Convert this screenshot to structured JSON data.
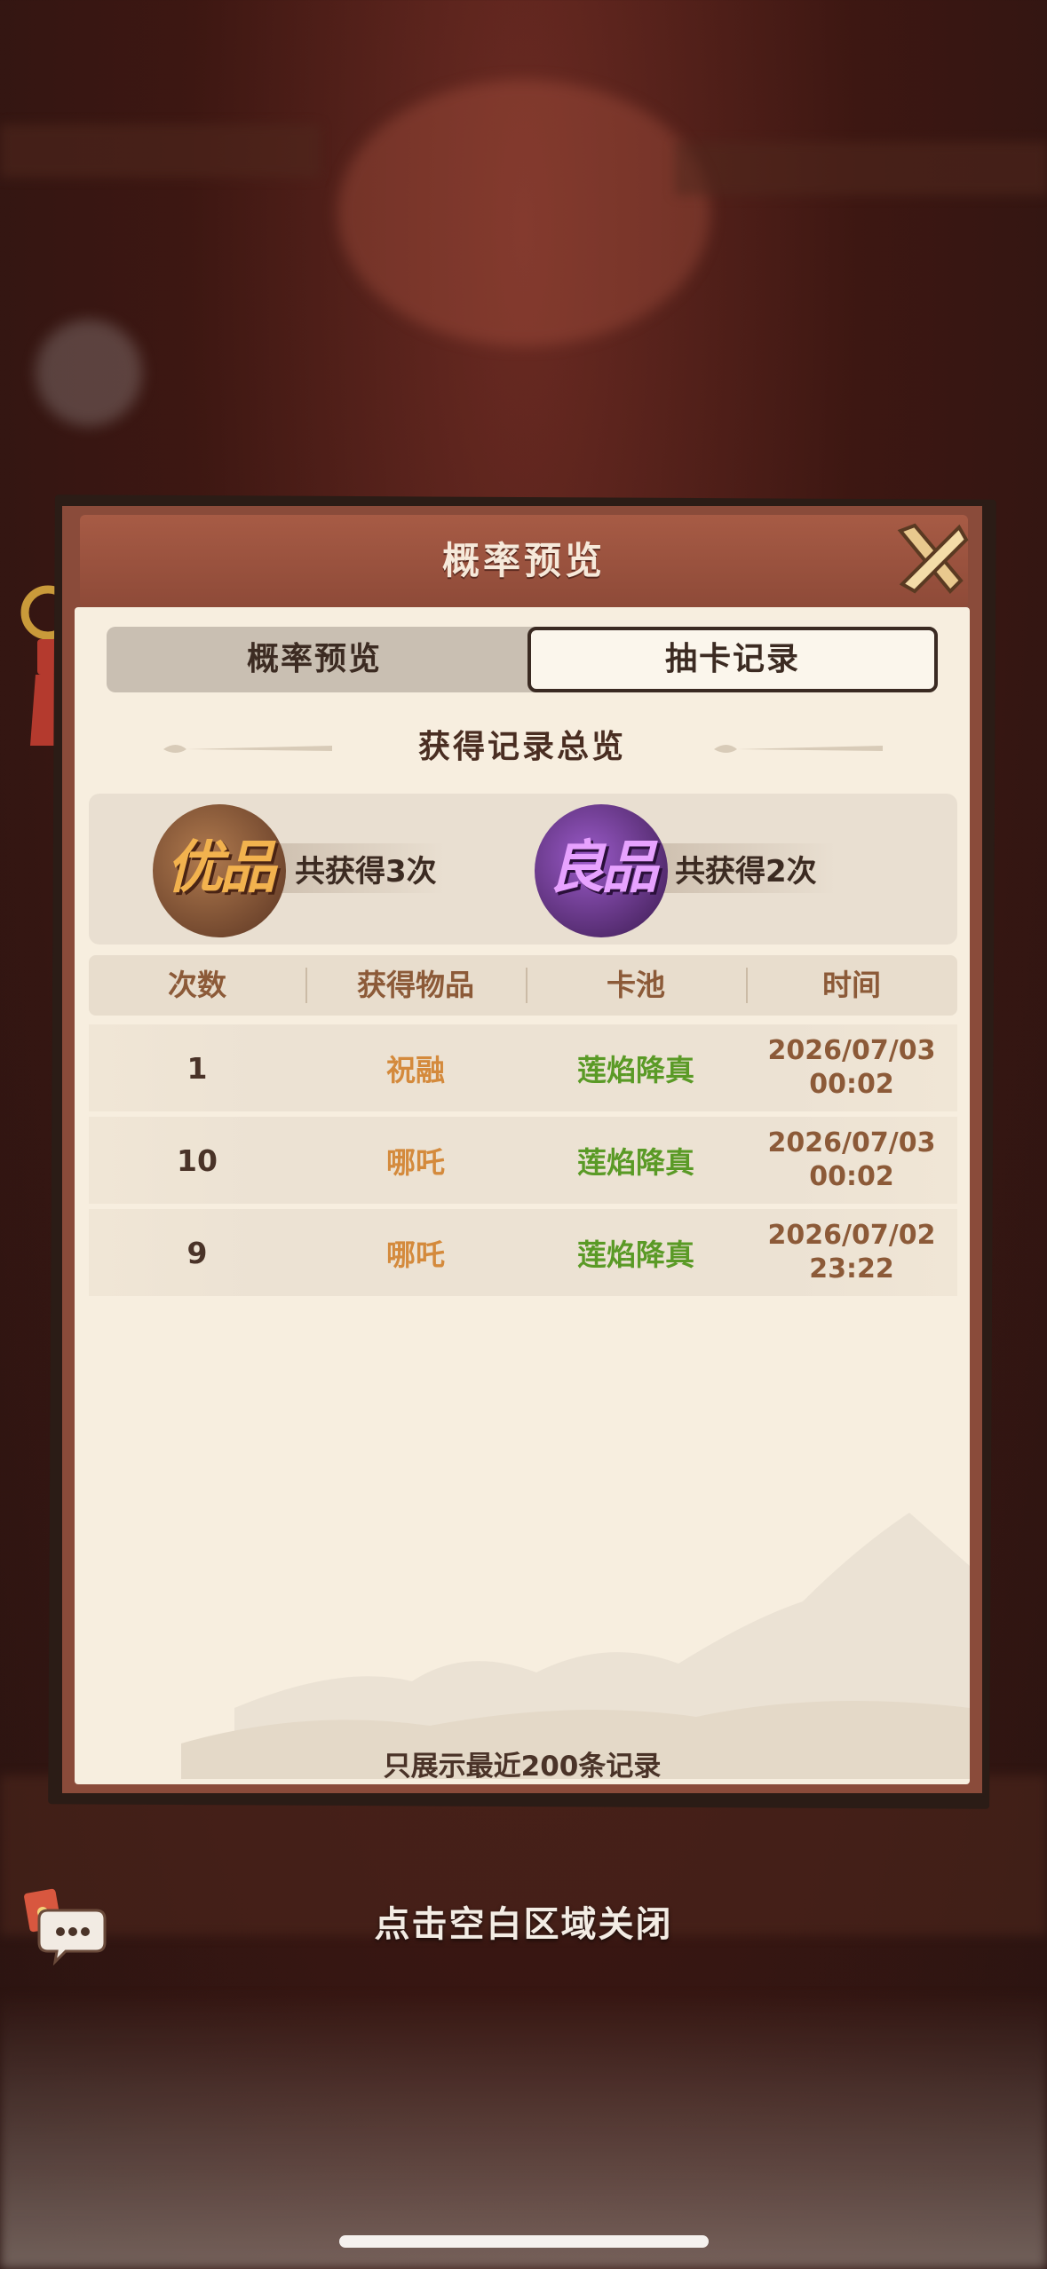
{
  "panel": {
    "title": "概率预览"
  },
  "tabs": [
    {
      "label": "概率预览",
      "active": false
    },
    {
      "label": "抽卡记录",
      "active": true
    }
  ],
  "summary": {
    "title": "获得记录总览",
    "items": [
      {
        "grade": "优品",
        "label": "共获得3次",
        "color": "#e3a24a"
      },
      {
        "grade": "良品",
        "label": "共获得2次",
        "color": "#b55be0"
      }
    ]
  },
  "table": {
    "headers": [
      "次数",
      "获得物品",
      "卡池",
      "时间"
    ],
    "rows": [
      {
        "count": "1",
        "item": "祝融",
        "pool": "莲焰降真",
        "time": "2026/07/03\n00:02"
      },
      {
        "count": "10",
        "item": "哪吒",
        "pool": "莲焰降真",
        "time": "2026/07/03\n00:02"
      },
      {
        "count": "9",
        "item": "哪吒",
        "pool": "莲焰降真",
        "time": "2026/07/02\n23:22"
      }
    ]
  },
  "footer_note": "只展示最近200条记录",
  "close_hint": "点击空白区域关闭",
  "colors": {
    "item": "#d48a3c",
    "pool": "#5a9a26",
    "header_text": "#8c5a38"
  },
  "icons": [
    "close-icon",
    "chat-icon",
    "red-packet-icon",
    "tassel-ornament"
  ]
}
